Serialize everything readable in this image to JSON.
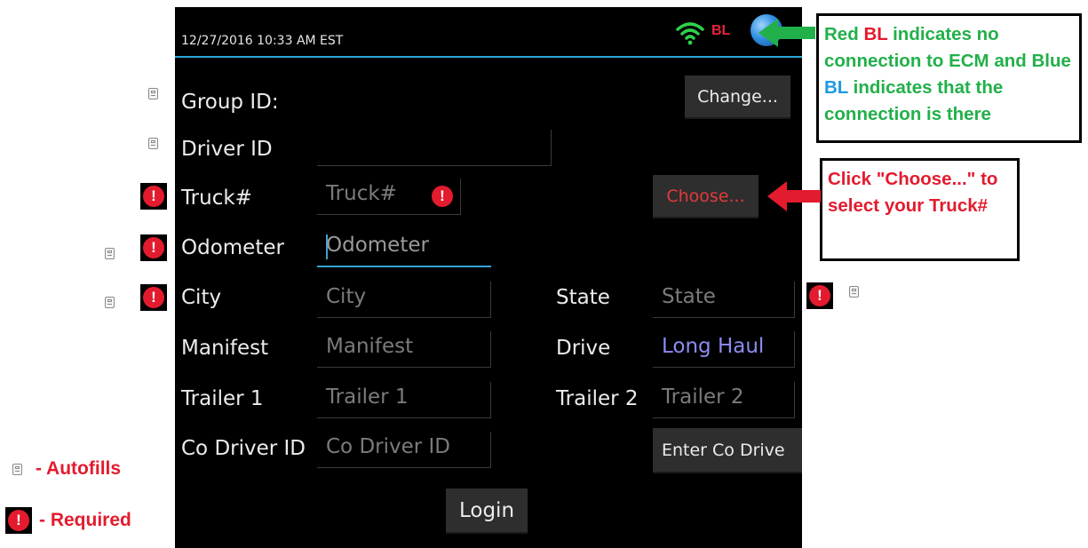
{
  "status_bar": {
    "datetime": "12/27/2016 10:33 AM EST",
    "connection_label": "BL",
    "connection_color": "#e8243c"
  },
  "form": {
    "group_id": {
      "label": "Group ID:",
      "button": "Change..."
    },
    "driver_id": {
      "label": "Driver ID",
      "value": ""
    },
    "truck": {
      "label": "Truck#",
      "placeholder": "Truck#",
      "button": "Choose...",
      "error_mark": "!"
    },
    "odometer": {
      "label": "Odometer",
      "placeholder": "Odometer"
    },
    "city": {
      "label": "City",
      "placeholder": "City"
    },
    "state": {
      "label": "State",
      "placeholder": "State"
    },
    "manifest": {
      "label": "Manifest",
      "placeholder": "Manifest"
    },
    "drive": {
      "label": "Drive",
      "value": "Long Haul"
    },
    "trailer1": {
      "label": "Trailer 1",
      "placeholder": "Trailer 1"
    },
    "trailer2": {
      "label": "Trailer 2",
      "placeholder": "Trailer 2"
    },
    "co_driver": {
      "label": "Co Driver ID",
      "placeholder": "Co Driver ID",
      "button": "Enter Co Drive"
    },
    "login_button": "Login"
  },
  "annotations": {
    "bl_callout": {
      "part1": "Red ",
      "bl_red": "BL",
      "part2": " indicates no connection to ECM and Blue ",
      "bl_blue": "BL",
      "part3": " indicates that the connection is there"
    },
    "choose_callout": "Click \"Choose...\" to select your Truck#",
    "legend": {
      "autofills": "- Autofills",
      "required": "- Required"
    },
    "required_mark": "!"
  },
  "colors": {
    "accent_blue": "#3aa3d6",
    "required_red": "#e31b2e",
    "callout_green": "#22b04a",
    "drive_value": "#8c8cf0"
  },
  "icons": [
    "wifi-icon",
    "globe-icon",
    "autofill-icon",
    "required-icon",
    "arrow-left-icon"
  ]
}
